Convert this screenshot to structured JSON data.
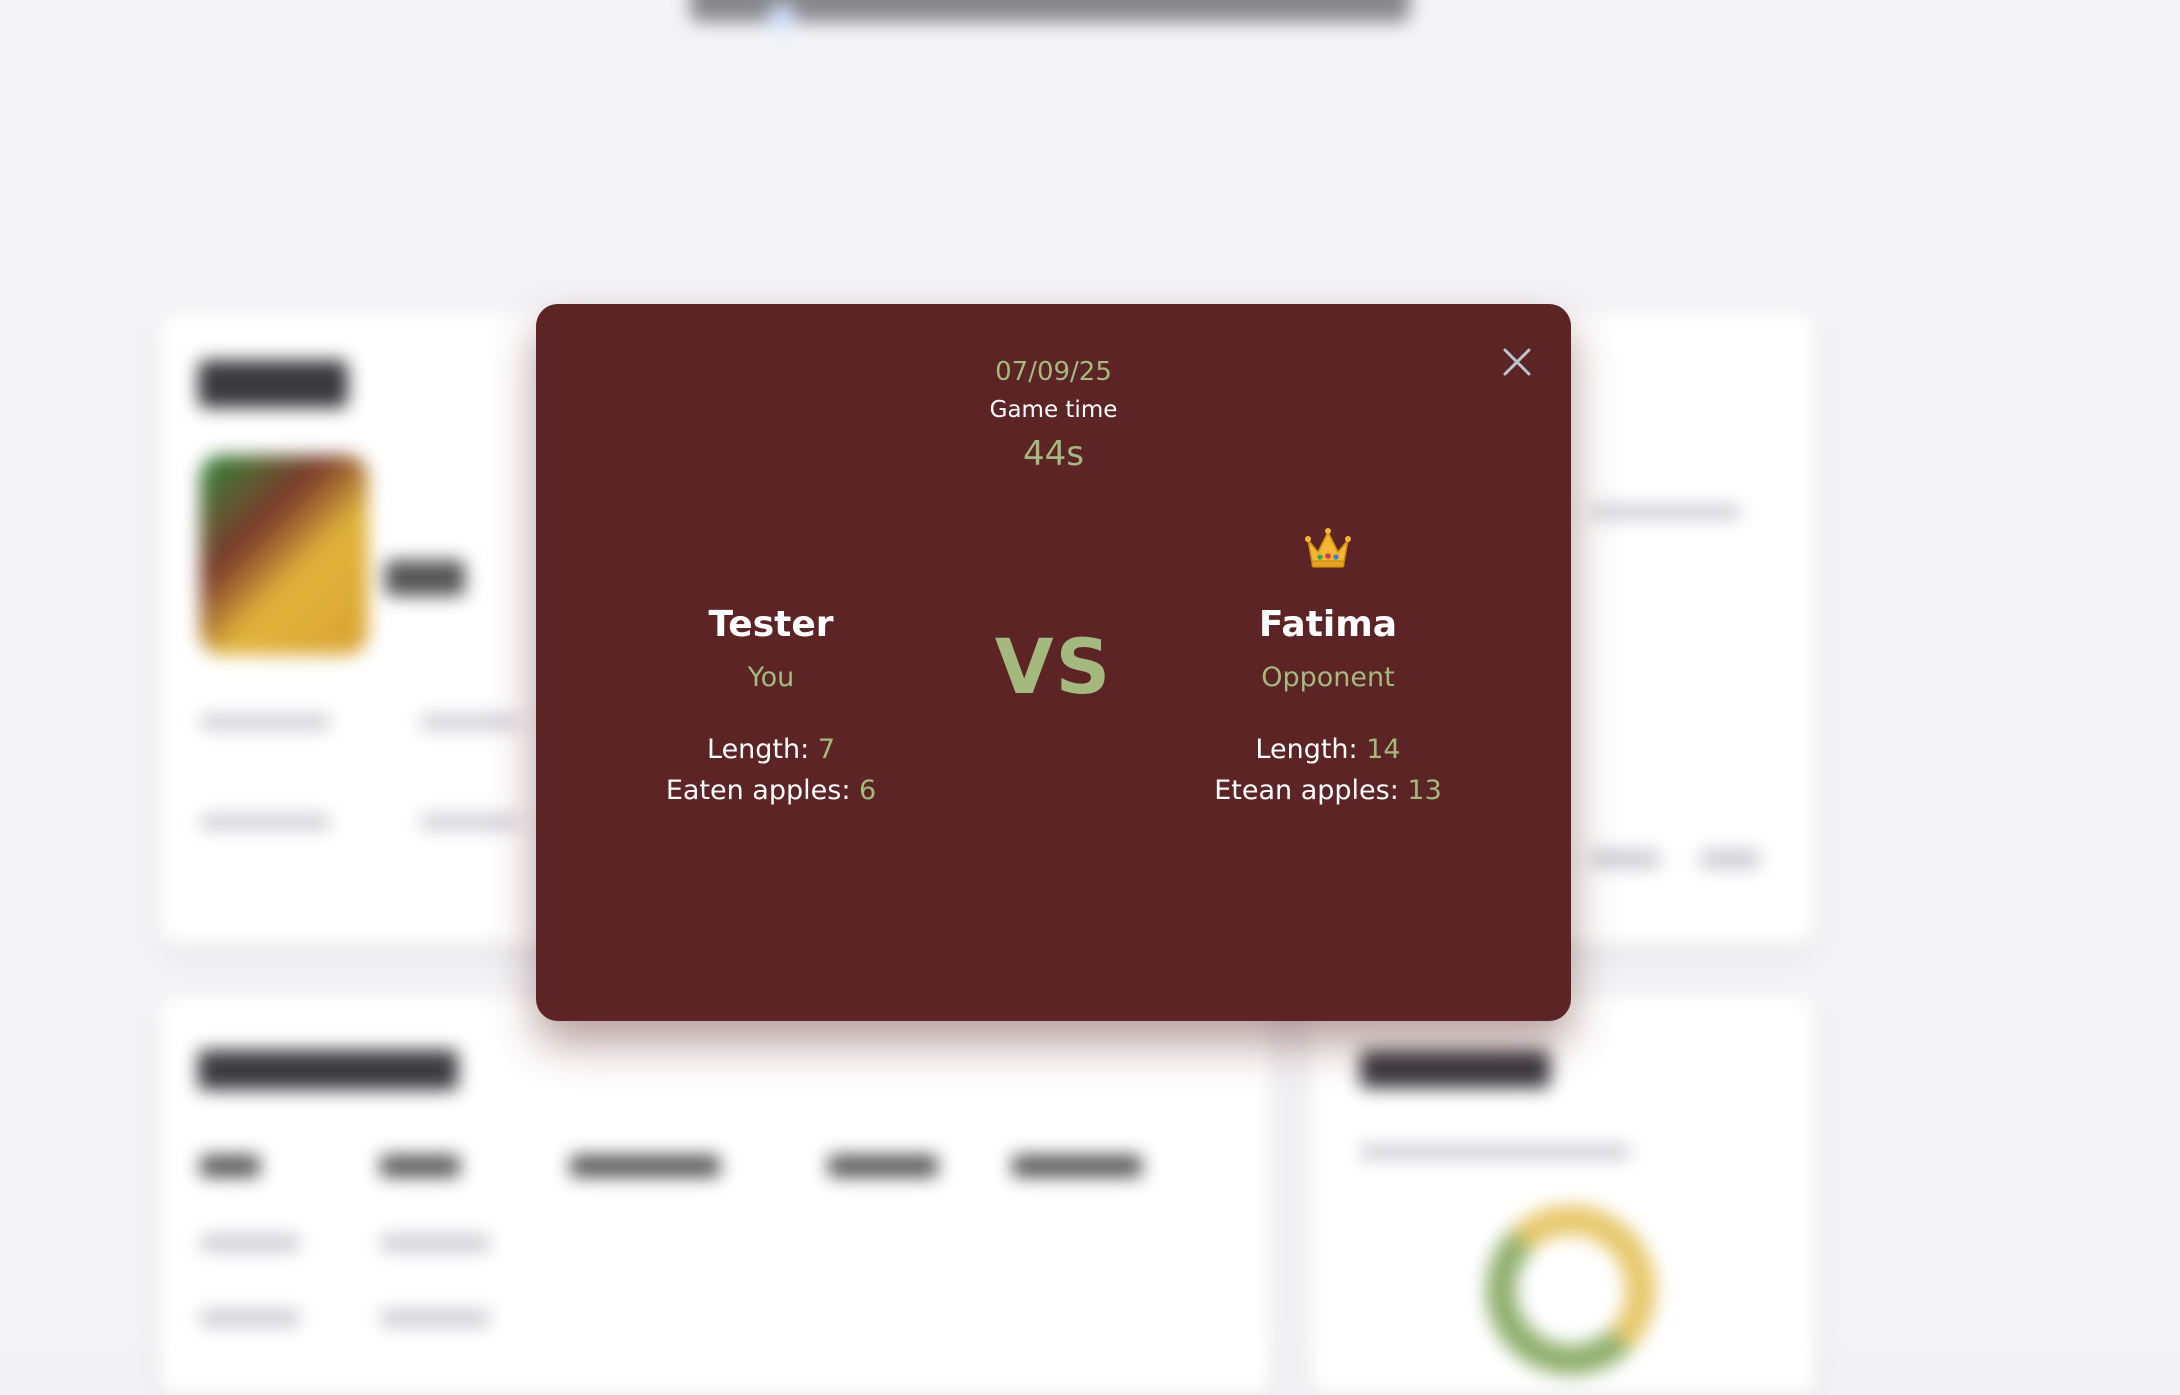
{
  "match": {
    "date": "07/09/25",
    "game_time_label": "Game time",
    "game_time_value": "44s",
    "vs_label": "VS"
  },
  "players": [
    {
      "name": "Tester",
      "role": "You",
      "length_label": "Length: ",
      "length_value": "7",
      "apples_label": "Eaten apples: ",
      "apples_value": "6",
      "winner": false
    },
    {
      "name": "Fatima",
      "role": "Opponent",
      "length_label": "Length: ",
      "length_value": "14",
      "apples_label": "Etean apples: ",
      "apples_value": "13",
      "winner": true,
      "winner_icon": "crown-icon"
    }
  ],
  "colors": {
    "modal_background": "#5c2425",
    "accent": "#a3b97d",
    "text": "#ffffff",
    "close_icon": "#b9c4cc"
  }
}
